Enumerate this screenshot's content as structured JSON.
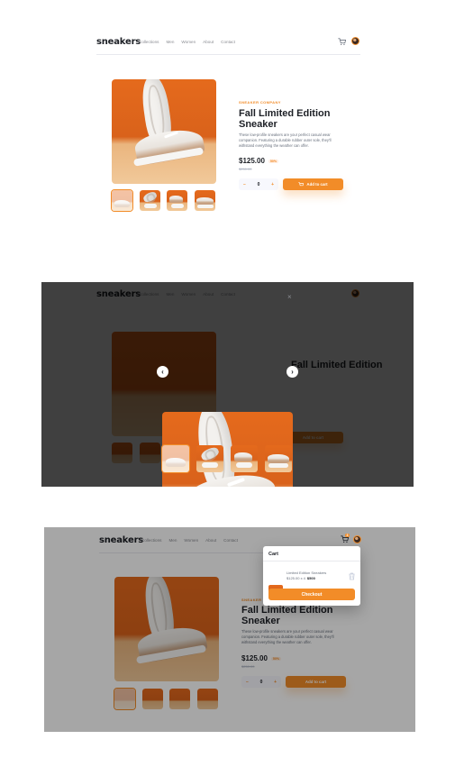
{
  "nav": {
    "logo": "sneakers",
    "links": [
      "Collections",
      "Men",
      "Women",
      "About",
      "Contact"
    ],
    "cart_count": "3"
  },
  "product": {
    "company": "SNEAKER COMPANY",
    "title_line1": "Fall Limited Edition",
    "title_line2": "Sneaker",
    "description": "These low-profile sneakers are your perfect casual wear companion. Featuring a durable rubber outer sole, they'll withstand everything the weather can offer.",
    "price": "$125.00",
    "discount": "50%",
    "old_price": "$250.00",
    "quantity": "0",
    "minus": "−",
    "plus": "+",
    "add_to_cart": "Add to cart"
  },
  "lightbox": {
    "close": "×",
    "prev": "‹",
    "next": "›"
  },
  "cart": {
    "title": "Cart",
    "item_name": "Limited Edition Sneakers",
    "item_price_calc": "$125.00 x 4",
    "item_total": "$500",
    "checkout": "Checkout"
  },
  "colors": {
    "accent": "#f28c28",
    "accent_light": "#ffeee2",
    "text_dark": "#1d2026",
    "text_muted": "#68707d"
  },
  "icons": [
    "cart-icon",
    "avatar",
    "trash-icon",
    "chevron-left-icon",
    "chevron-right-icon",
    "close-icon"
  ]
}
